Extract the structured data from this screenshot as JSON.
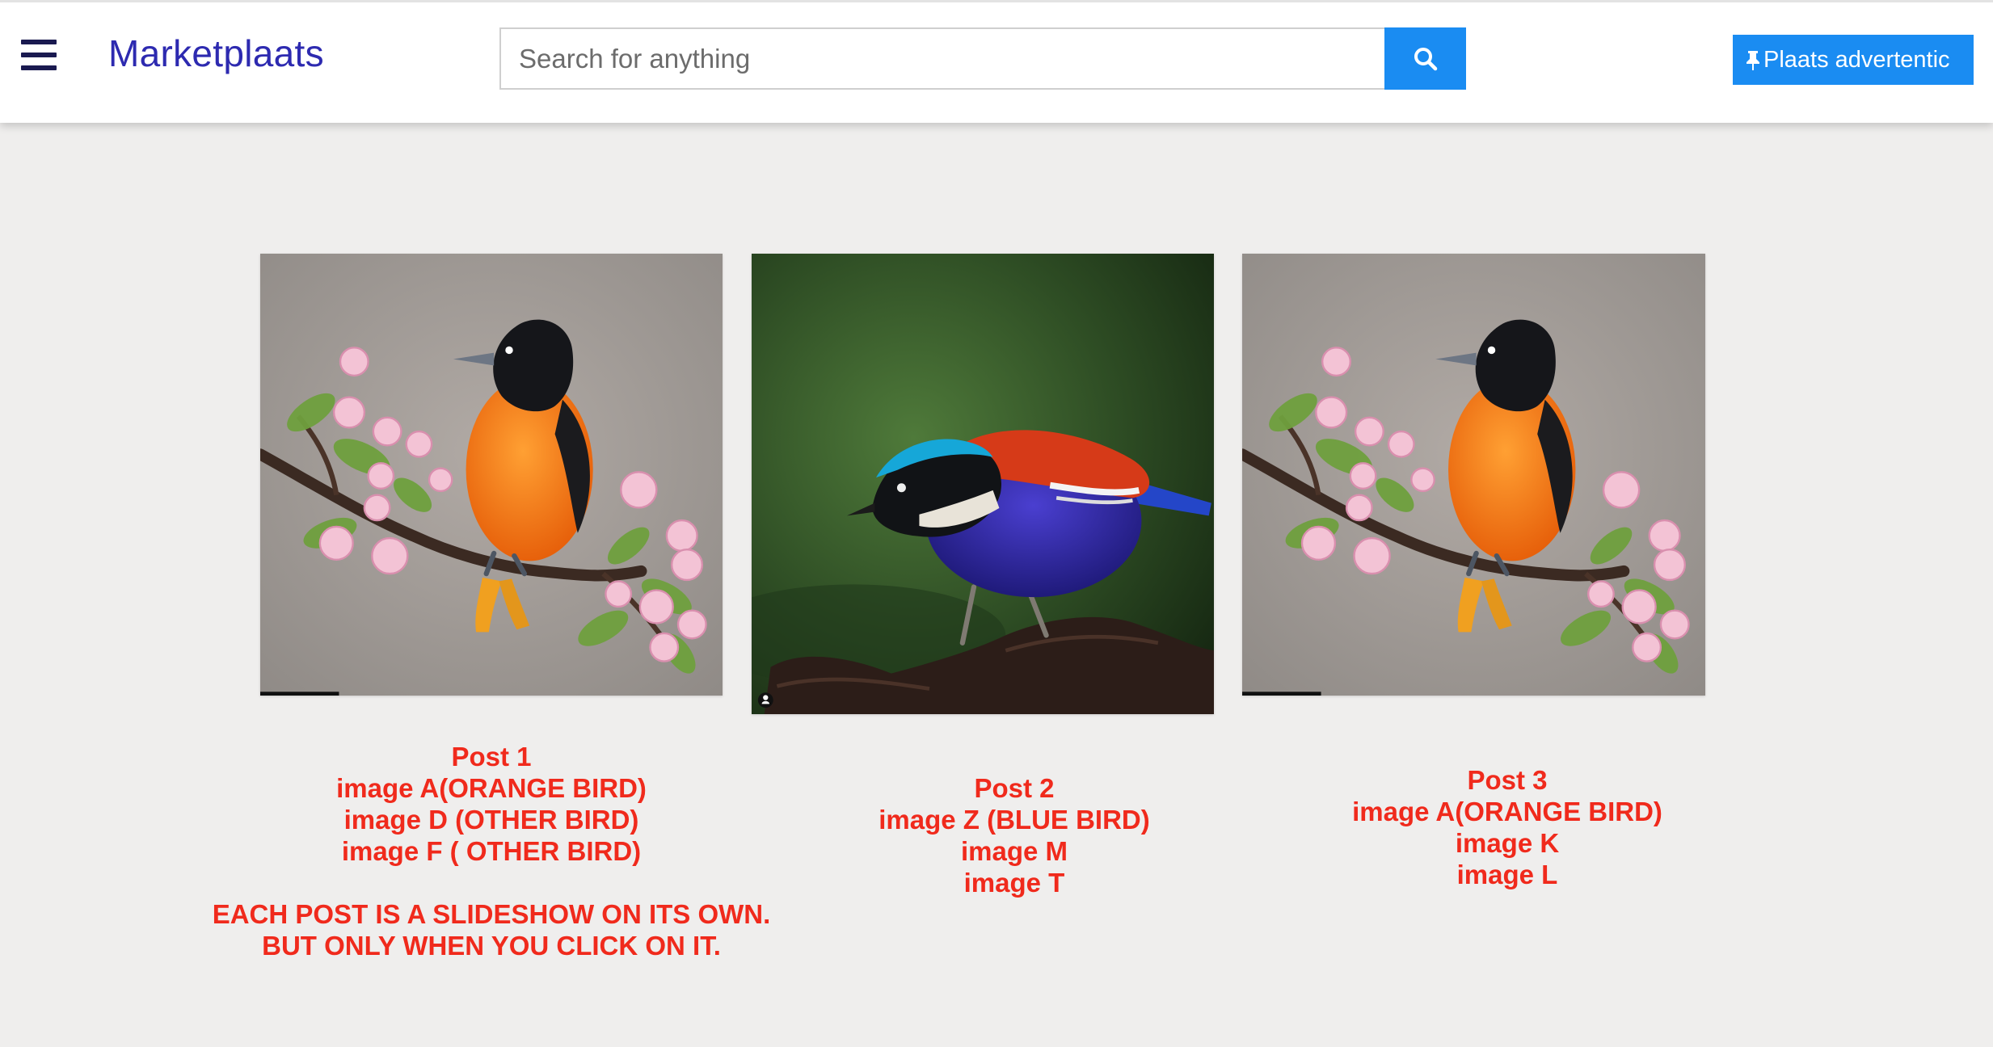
{
  "header": {
    "brand": "Marketplaats",
    "search_placeholder": "Search for anything",
    "place_ad_label": "Plaats advertentic",
    "icons": {
      "menu": "hamburger-menu-icon",
      "search": "search-icon",
      "pin": "pushpin-icon"
    },
    "colors": {
      "brand": "#2d2ab0",
      "accent": "#1a8cf2",
      "annotation": "#f02a1c"
    }
  },
  "posts": [
    {
      "image": "orange-bird-photo",
      "caption": [
        "Post 1",
        "image A(ORANGE BIRD)",
        "image D (OTHER BIRD)",
        "image F ( OTHER BIRD)"
      ],
      "note": [
        "EACH POST IS A SLIDESHOW ON ITS OWN.",
        "BUT ONLY WHEN YOU CLICK ON IT."
      ]
    },
    {
      "image": "blue-bird-photo",
      "caption": [
        "Post 2",
        "image Z (BLUE BIRD)",
        "image M",
        "image T"
      ]
    },
    {
      "image": "orange-bird-photo",
      "caption": [
        "Post 3",
        "image A(ORANGE BIRD)",
        "image K",
        "image L"
      ]
    }
  ]
}
